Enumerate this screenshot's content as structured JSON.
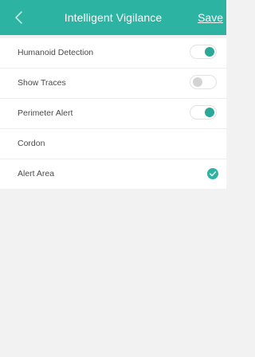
{
  "header": {
    "title": "Intelligent Vigilance",
    "save_label": "Save",
    "back_icon": "chevron-left-icon"
  },
  "colors": {
    "accent": "#2cb3a2",
    "toggle_on": "#2aa898",
    "toggle_off": "#d3d3d3",
    "background": "#f2f2f2"
  },
  "settings": [
    {
      "label": "Humanoid Detection",
      "control": "toggle",
      "value": true
    },
    {
      "label": "Show Traces",
      "control": "toggle",
      "value": false
    },
    {
      "label": "Perimeter Alert",
      "control": "toggle",
      "value": true
    },
    {
      "label": "Cordon",
      "control": "none"
    },
    {
      "label": "Alert Area",
      "control": "check",
      "value": true,
      "icon": "checkmark-icon"
    }
  ]
}
